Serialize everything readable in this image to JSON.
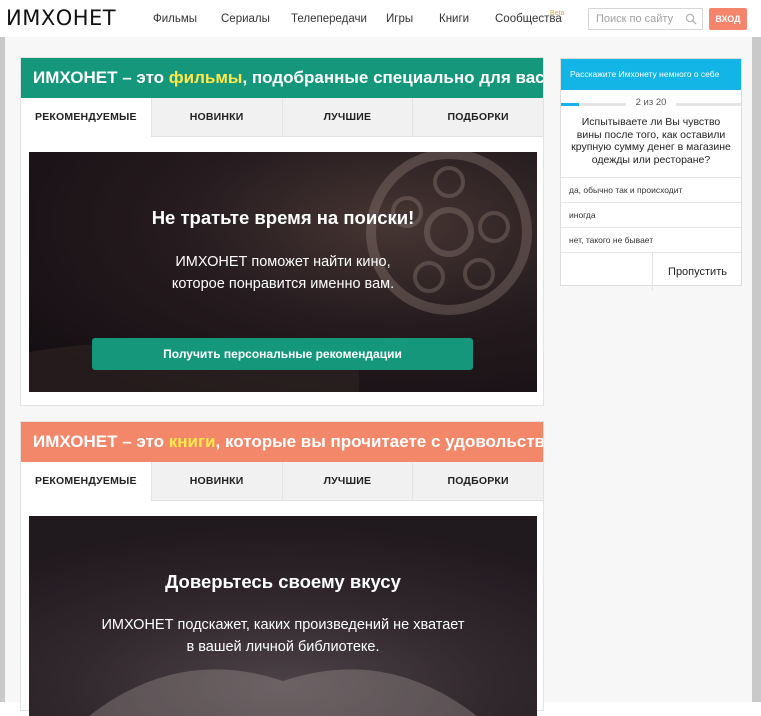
{
  "header": {
    "logo": "ИМХОНЕТ",
    "nav": [
      "Фильмы",
      "Сериалы",
      "Телепередачи",
      "Игры",
      "Книги",
      "Сообщества"
    ],
    "beta_badge": "Beta",
    "search_placeholder": "Поиск по сайту",
    "login_label": "ВХОД"
  },
  "colors": {
    "movies_accent": "#15977c",
    "books_accent": "#f3876a",
    "highlight": "#ffe94a",
    "survey_accent": "#13b4e6"
  },
  "movies": {
    "title_prefix": "ИМХОНЕТ – это ",
    "title_highlight": "фильмы",
    "title_suffix": ", подобранные специально для вас",
    "tabs": [
      "РЕКОМЕНДУЕМЫЕ",
      "НОВИНКИ",
      "ЛУЧШИЕ",
      "ПОДБОРКИ"
    ],
    "hero_heading": "Не тратьте время на поиски!",
    "hero_line1": "ИМХОНЕТ поможет найти кино,",
    "hero_line2": "которое понравится именно вам.",
    "cta": "Получить персональные рекомендации"
  },
  "books": {
    "title_prefix": "ИМХОНЕТ – это ",
    "title_highlight": "книги",
    "title_suffix": ", которые вы прочитаете с удовольствием",
    "tabs": [
      "РЕКОМЕНДУЕМЫЕ",
      "НОВИНКИ",
      "ЛУЧШИЕ",
      "ПОДБОРКИ"
    ],
    "hero_heading": "Доверьтесь своему вкусу",
    "hero_line1": "ИМХОНЕТ подскажет, каких произведений не хватает",
    "hero_line2": "в вашей личной библиотеке."
  },
  "survey": {
    "header": "Расскажите Имхонету немного о себе",
    "counter": "2 из 20",
    "progress": 0.1,
    "question": "Испытываете ли Вы чувство вины после того, как оставили крупную сумму денег в магазине одежды или ресторане?",
    "answers": [
      "да, обычно так и происходит",
      "иногда",
      "нет, такого не бывает"
    ],
    "skip": "Пропустить"
  }
}
